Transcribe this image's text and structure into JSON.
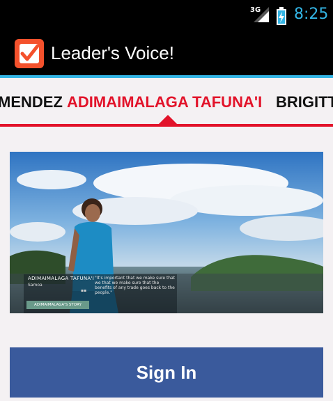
{
  "status_bar": {
    "network": "3G",
    "time": "8:25"
  },
  "action_bar": {
    "title": "Leader's Voice!"
  },
  "tabs": [
    {
      "label": "MENDEZ",
      "active": false
    },
    {
      "label": "ADIMAIMALAGA TAFUNA'I",
      "active": true
    },
    {
      "label": "BRIGITTE",
      "active": false
    }
  ],
  "hero": {
    "name": "ADIMAIMALAGA TAFUNA'I",
    "place": "Samoa",
    "quote": "\"It's important that we make sure that we that we make sure that the benefits of any trade goes back to the people.\"",
    "story_button": "ADIMAIMALAGA'S STORY"
  },
  "sign_in": {
    "label": "Sign In"
  },
  "colors": {
    "accent": "#e2132a",
    "holo_blue": "#33b5e5",
    "facebook_blue": "#3a5a9c"
  }
}
